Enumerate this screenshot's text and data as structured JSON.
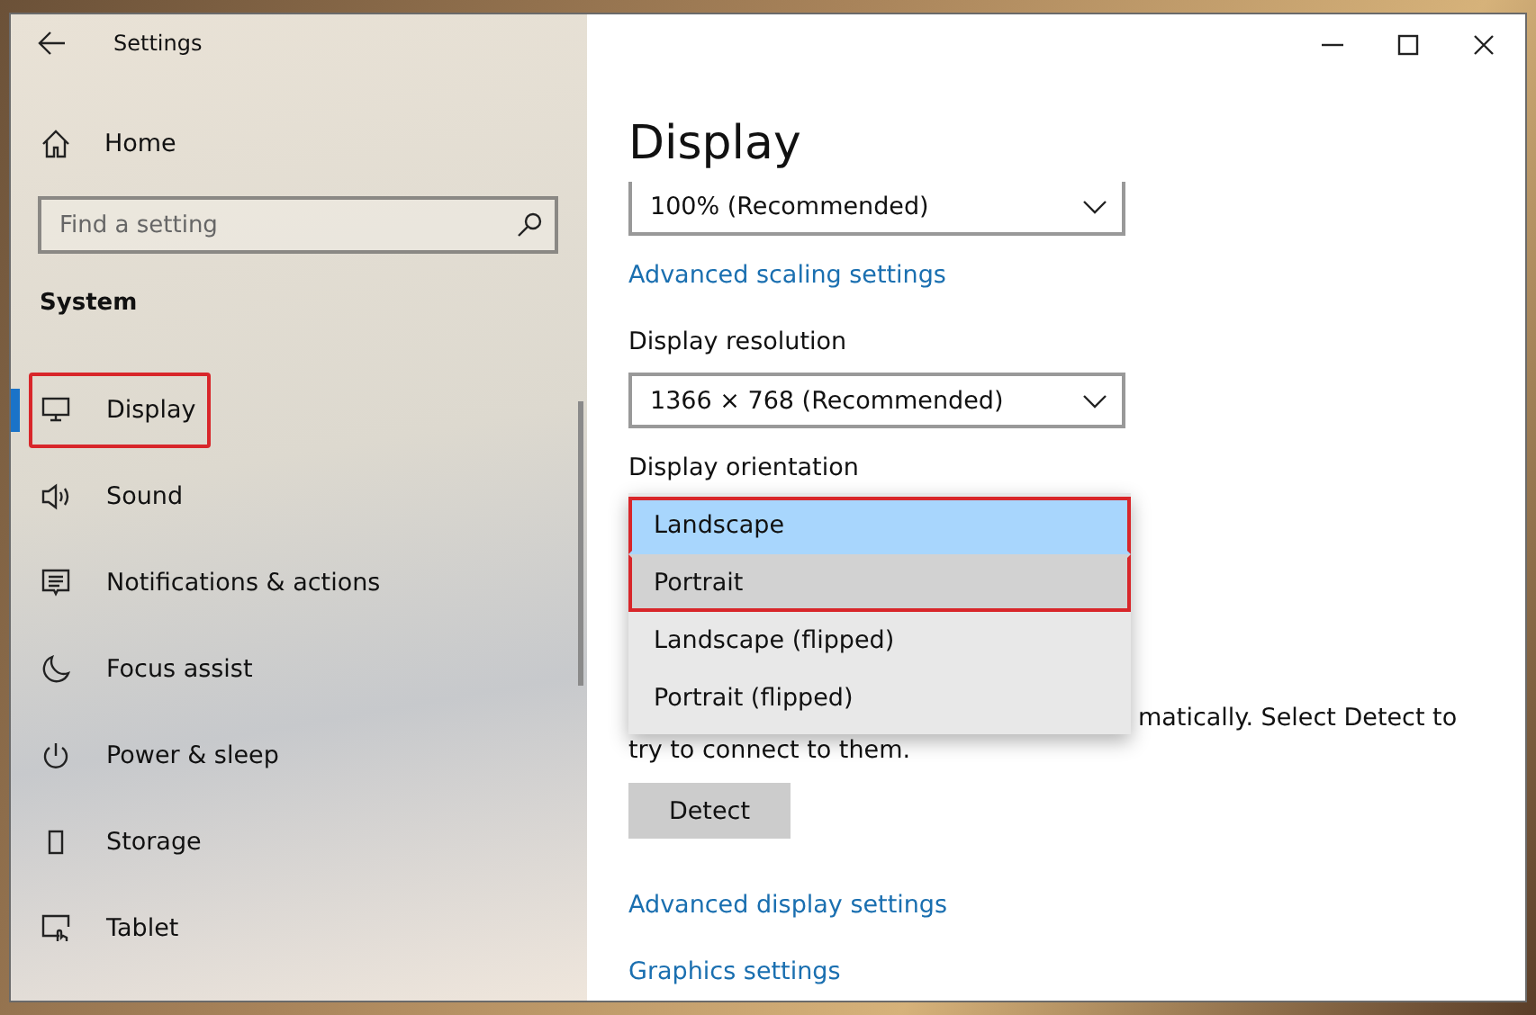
{
  "window": {
    "title": "Settings"
  },
  "sidebar": {
    "home": "Home",
    "search": {
      "placeholder": "Find a setting"
    },
    "section": "System",
    "items": [
      {
        "label": "Display",
        "selected": true,
        "highlighted": true
      },
      {
        "label": "Sound",
        "selected": false,
        "highlighted": false
      },
      {
        "label": "Notifications & actions",
        "selected": false,
        "highlighted": false
      },
      {
        "label": "Focus assist",
        "selected": false,
        "highlighted": false
      },
      {
        "label": "Power & sleep",
        "selected": false,
        "highlighted": false
      },
      {
        "label": "Storage",
        "selected": false,
        "highlighted": false
      },
      {
        "label": "Tablet",
        "selected": false,
        "highlighted": false
      }
    ]
  },
  "content": {
    "title": "Display",
    "scale": {
      "value": "100% (Recommended)"
    },
    "scaling_link": "Advanced scaling settings",
    "resolution": {
      "label": "Display resolution",
      "value": "1366 × 768 (Recommended)"
    },
    "orientation": {
      "label": "Display orientation",
      "options": [
        {
          "label": "Landscape",
          "selected": true,
          "hovered": false,
          "highlighted": true
        },
        {
          "label": "Portrait",
          "selected": false,
          "hovered": true,
          "highlighted": true
        },
        {
          "label": "Landscape (flipped)",
          "selected": false,
          "hovered": false,
          "highlighted": false
        },
        {
          "label": "Portrait (flipped)",
          "selected": false,
          "hovered": false,
          "highlighted": false
        }
      ]
    },
    "detect_text": [
      "matically. Select Detect to",
      "try to connect to them."
    ],
    "detect_button": "Detect",
    "links": [
      "Advanced display settings",
      "Graphics settings"
    ]
  }
}
